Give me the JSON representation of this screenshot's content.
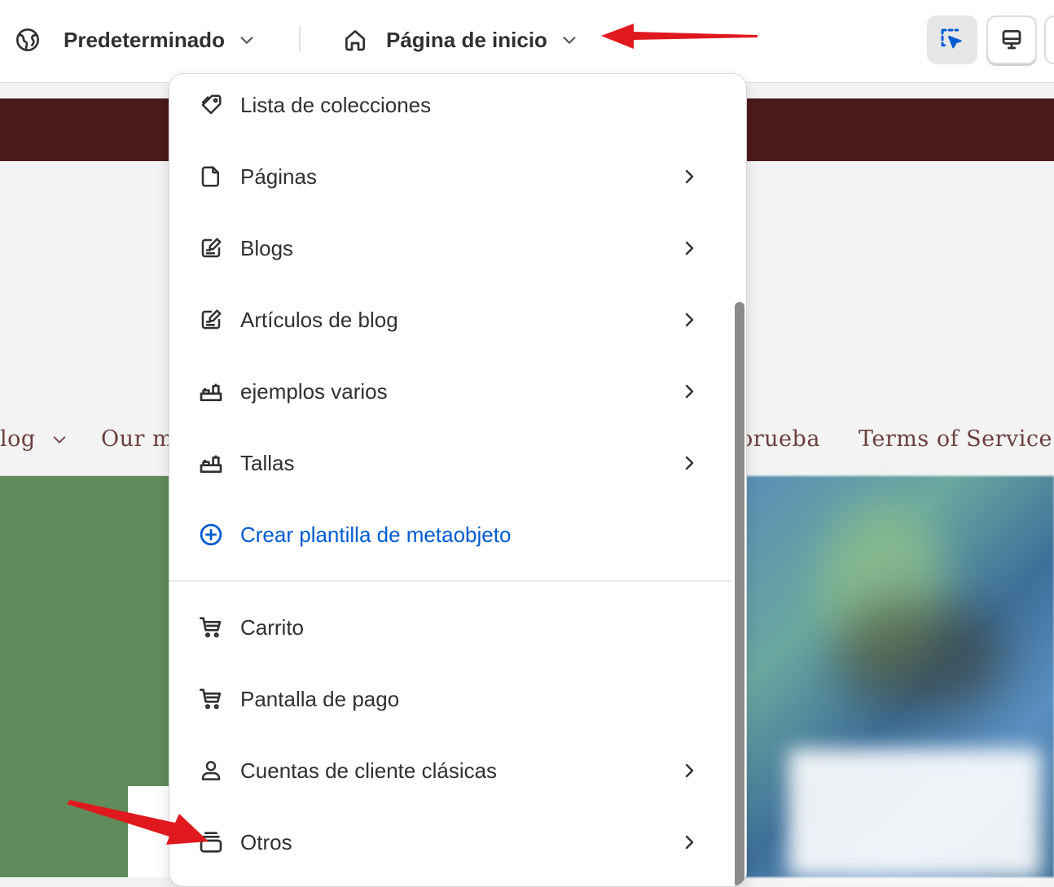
{
  "topbar": {
    "theme_label": "Predeterminado",
    "template_label": "Página de inicio",
    "icons": {
      "theme": "globe-icon",
      "template": "home-icon",
      "chevron": "chevron-down-icon",
      "select_tool": "select-cursor-icon",
      "desktop": "desktop-icon"
    }
  },
  "preview": {
    "nav_links": [
      "log",
      "Our m",
      "orueba",
      "Terms of Service"
    ]
  },
  "menu": {
    "items": [
      {
        "label": "Lista de colecciones",
        "icon": "collection-tag-icon",
        "has_submenu": false
      },
      {
        "label": "Páginas",
        "icon": "page-icon",
        "has_submenu": true
      },
      {
        "label": "Blogs",
        "icon": "blog-icon",
        "has_submenu": true
      },
      {
        "label": "Artículos de blog",
        "icon": "blog-post-icon",
        "has_submenu": true
      },
      {
        "label": "ejemplos varios",
        "icon": "metaobject-icon",
        "has_submenu": true
      },
      {
        "label": "Tallas",
        "icon": "metaobject-icon",
        "has_submenu": true
      },
      {
        "label": "Crear plantilla de metaobjeto",
        "icon": "plus-circle-icon",
        "has_submenu": false
      },
      {
        "label": "Carrito",
        "icon": "cart-icon",
        "has_submenu": false
      },
      {
        "label": "Pantalla de pago",
        "icon": "cart-icon",
        "has_submenu": false
      },
      {
        "label": "Cuentas de cliente clásicas",
        "icon": "person-icon",
        "has_submenu": true
      },
      {
        "label": "Otros",
        "icon": "stack-icon",
        "has_submenu": true
      }
    ]
  },
  "colors": {
    "accent": "#005bd3",
    "announcement_bar": "#4b1a1a",
    "annotation_arrow": "#e0191f",
    "nav_link": "#6b3e3e"
  }
}
